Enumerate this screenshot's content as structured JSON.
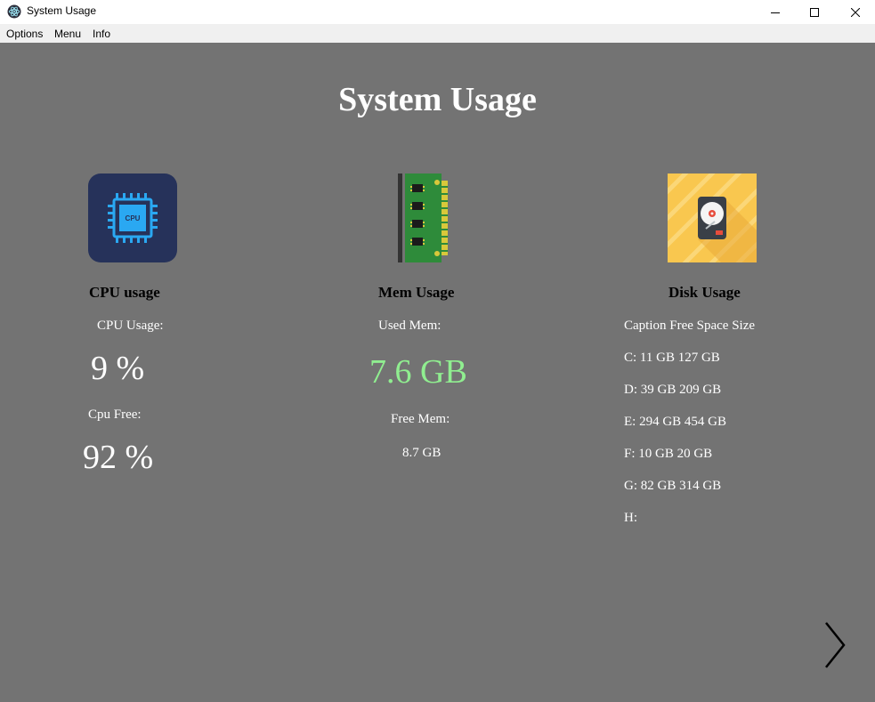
{
  "window": {
    "title": "System Usage",
    "icon": "electron-icon"
  },
  "menubar": {
    "items": [
      "Options",
      "Menu",
      "Info"
    ]
  },
  "page": {
    "title": "System Usage"
  },
  "cpu": {
    "icon": "cpu-icon",
    "icon_text": "CPU",
    "heading": "CPU usage",
    "usage_label": "CPU Usage:",
    "usage_value": "9 %",
    "free_label": "Cpu Free:",
    "free_value": "92 %"
  },
  "mem": {
    "icon": "ram-icon",
    "heading": "Mem Usage",
    "used_label": "Used Mem:",
    "used_value": "7.6 GB",
    "free_label": "Free Mem:",
    "free_value": "8.7 GB"
  },
  "disk": {
    "icon": "hard-drive-icon",
    "heading": "Disk Usage",
    "columns_caption": "Caption Free Space Size",
    "drives": [
      "C: 11 GB 127 GB",
      "D: 39 GB 209 GB",
      "E: 294 GB 454 GB",
      "F: 10 GB 20 GB",
      "G: 82 GB 314 GB",
      "H:"
    ]
  },
  "navigation": {
    "next_icon": "chevron-right-icon"
  },
  "colors": {
    "background": "#737373",
    "accent_green": "#90ee90",
    "cpu_icon_bg": "#26325a",
    "disk_icon_bg": "#f9c74f"
  }
}
